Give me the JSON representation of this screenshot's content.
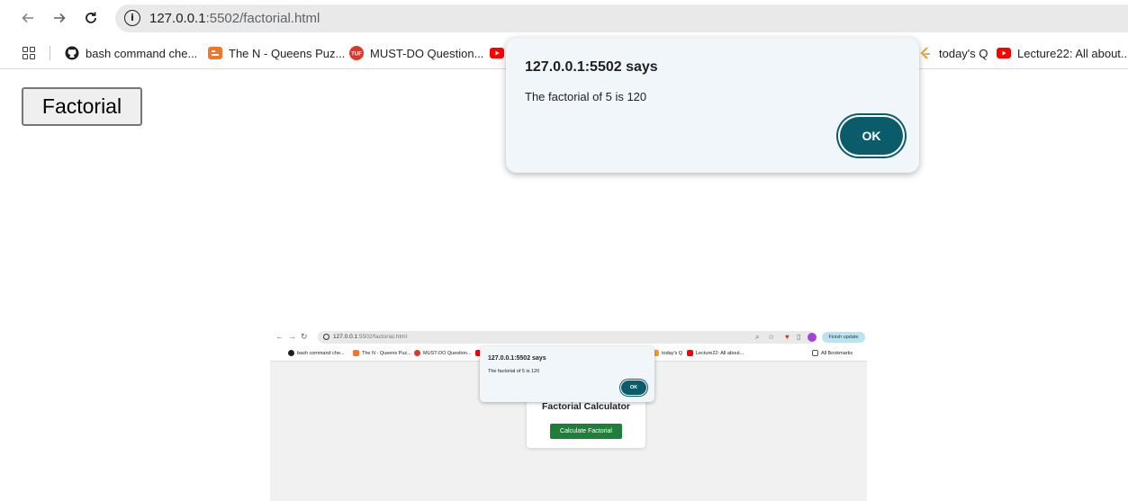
{
  "browser": {
    "url_host": "127.0.0.1",
    "url_rest": ":5502/factorial.html",
    "bookmarks": [
      {
        "label": "bash command che...",
        "icon": "github-icon"
      },
      {
        "label": "The N - Queens Puz...",
        "icon": "codingninjas-icon"
      },
      {
        "label": "MUST-DO Question...",
        "icon": "tuf-icon"
      },
      {
        "label": "",
        "icon": "youtube-icon"
      },
      {
        "label": "today's Q",
        "icon": "leetcode-icon"
      },
      {
        "label": "Lecture22: All about...",
        "icon": "youtube-icon"
      }
    ]
  },
  "page": {
    "factorial_button_label": "Factorial"
  },
  "dialog": {
    "title": "127.0.0.1:5502 says",
    "message": "The factorial of 5 is 120",
    "ok_label": "OK",
    "accent": "#0b5c6b"
  },
  "thumbnail": {
    "url_host": "127.0.0.1",
    "url_rest": ":5502/factorial.html",
    "update_label": "Finish update",
    "bookmarks": [
      "bash command che...",
      "The N - Queens Puz...",
      "MUST-DO Question...",
      "today's Q",
      "Lecture22: All about...",
      "All Bookmarks"
    ],
    "dialog_title": "127.0.0.1:5502 says",
    "dialog_message": "The factorial of 5 is 120",
    "dialog_ok": "OK",
    "card_title": "Factorial Calculator",
    "card_button": "Calculate Factorial",
    "button_color": "#1f7e3a"
  }
}
